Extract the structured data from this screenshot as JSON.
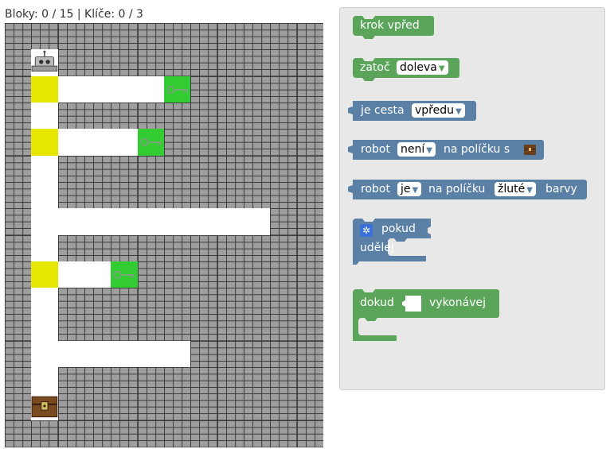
{
  "status": {
    "text": "Bloky: 0 / 15 | Klíče: 0 / 3"
  },
  "maze": {
    "rows": [
      "WWWWWWWWWWWW",
      "WRWWWWWWWWWW",
      "WYPPPPGWWWWW",
      "WPWWWWWWWWWW",
      "WYPPPGWWWWWW",
      "WPWWWWWWWWWW",
      "WPWWWWWWWWWW",
      "WPPPPPPPPPWW",
      "WPWWWWWWWWWW",
      "WYPPGWWWWWWW",
      "WPWWWWWWWWWW",
      "WPWWWWWWWWWW",
      "WPPPPPPWWWWW",
      "WPWWWWWWWWWW",
      "WTWWWWWWWWWW",
      "WWWWWWWWWWWW"
    ],
    "colors": {
      "wall": "#9e9e9e",
      "path": "#ffffff",
      "yellow": "#e6e600",
      "key_cell": "#33cc33"
    },
    "icons": {
      "robot": "robot-icon",
      "key": "key-icon",
      "chest": "chest-icon"
    }
  },
  "toolbox": {
    "colors": {
      "green": "#5ba55b",
      "blue": "#5b80a5"
    },
    "forward": {
      "label": "krok vpřed"
    },
    "turn": {
      "label": "zatoč",
      "dir": "doleva"
    },
    "path_check": {
      "label": "je cesta",
      "dir": "vpředu"
    },
    "robot_on": {
      "label": "robot",
      "neg": "není",
      "mid": "na políčku s"
    },
    "robot_color": {
      "label": "robot",
      "neg": "je",
      "mid": "na políčku",
      "color": "žluté",
      "end": "barvy"
    },
    "if_block": {
      "label": "pokud",
      "do": "udělej"
    },
    "while_block": {
      "label": "dokud",
      "do": "vykonávej"
    }
  }
}
